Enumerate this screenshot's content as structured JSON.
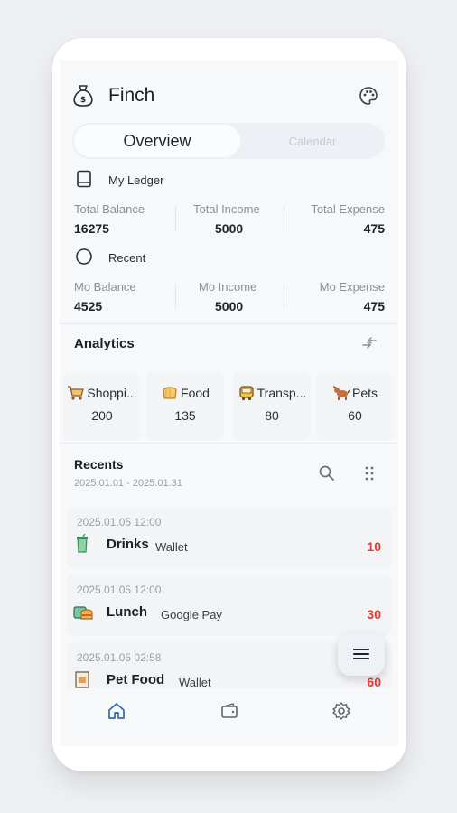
{
  "app": {
    "title": "Finch"
  },
  "tabs": {
    "overview": "Overview",
    "calendar": "Calendar"
  },
  "ledger": {
    "name": "My Ledger",
    "total": {
      "balance_label": "Total Balance",
      "balance_value": "16275",
      "income_label": "Total Income",
      "income_value": "5000",
      "expense_label": "Total Expense",
      "expense_value": "475"
    },
    "recent_label": "Recent",
    "monthly": {
      "balance_label": "Mo Balance",
      "balance_value": "4525",
      "income_label": "Mo Income",
      "income_value": "5000",
      "expense_label": "Mo Expense",
      "expense_value": "475"
    }
  },
  "analytics": {
    "title": "Analytics",
    "categories": [
      {
        "label": "Shoppi...",
        "value": "200",
        "icon": "shopping-cart-icon"
      },
      {
        "label": "Food",
        "value": "135",
        "icon": "food-icon"
      },
      {
        "label": "Transp...",
        "value": "80",
        "icon": "transport-icon"
      },
      {
        "label": "Pets",
        "value": "60",
        "icon": "pet-icon"
      }
    ]
  },
  "recents": {
    "title": "Recents",
    "range": "2025.01.01 - 2025.01.31",
    "items": [
      {
        "date": "2025.01.05 12:00",
        "name": "Drinks",
        "payment": "Wallet",
        "amount": "10",
        "icon": "drink-icon"
      },
      {
        "date": "2025.01.05 12:00",
        "name": "Lunch",
        "payment": "Google Pay",
        "amount": "30",
        "icon": "lunch-icon"
      },
      {
        "date": "2025.01.05 02:58",
        "name": "Pet Food",
        "payment": "Wallet",
        "amount": "60",
        "icon": "pet-food-icon"
      }
    ]
  },
  "colors": {
    "expense": "#e53935",
    "accent": "#2b6cb0"
  },
  "nav": {
    "items": [
      "home-icon",
      "wallet-icon",
      "settings-icon"
    ]
  }
}
